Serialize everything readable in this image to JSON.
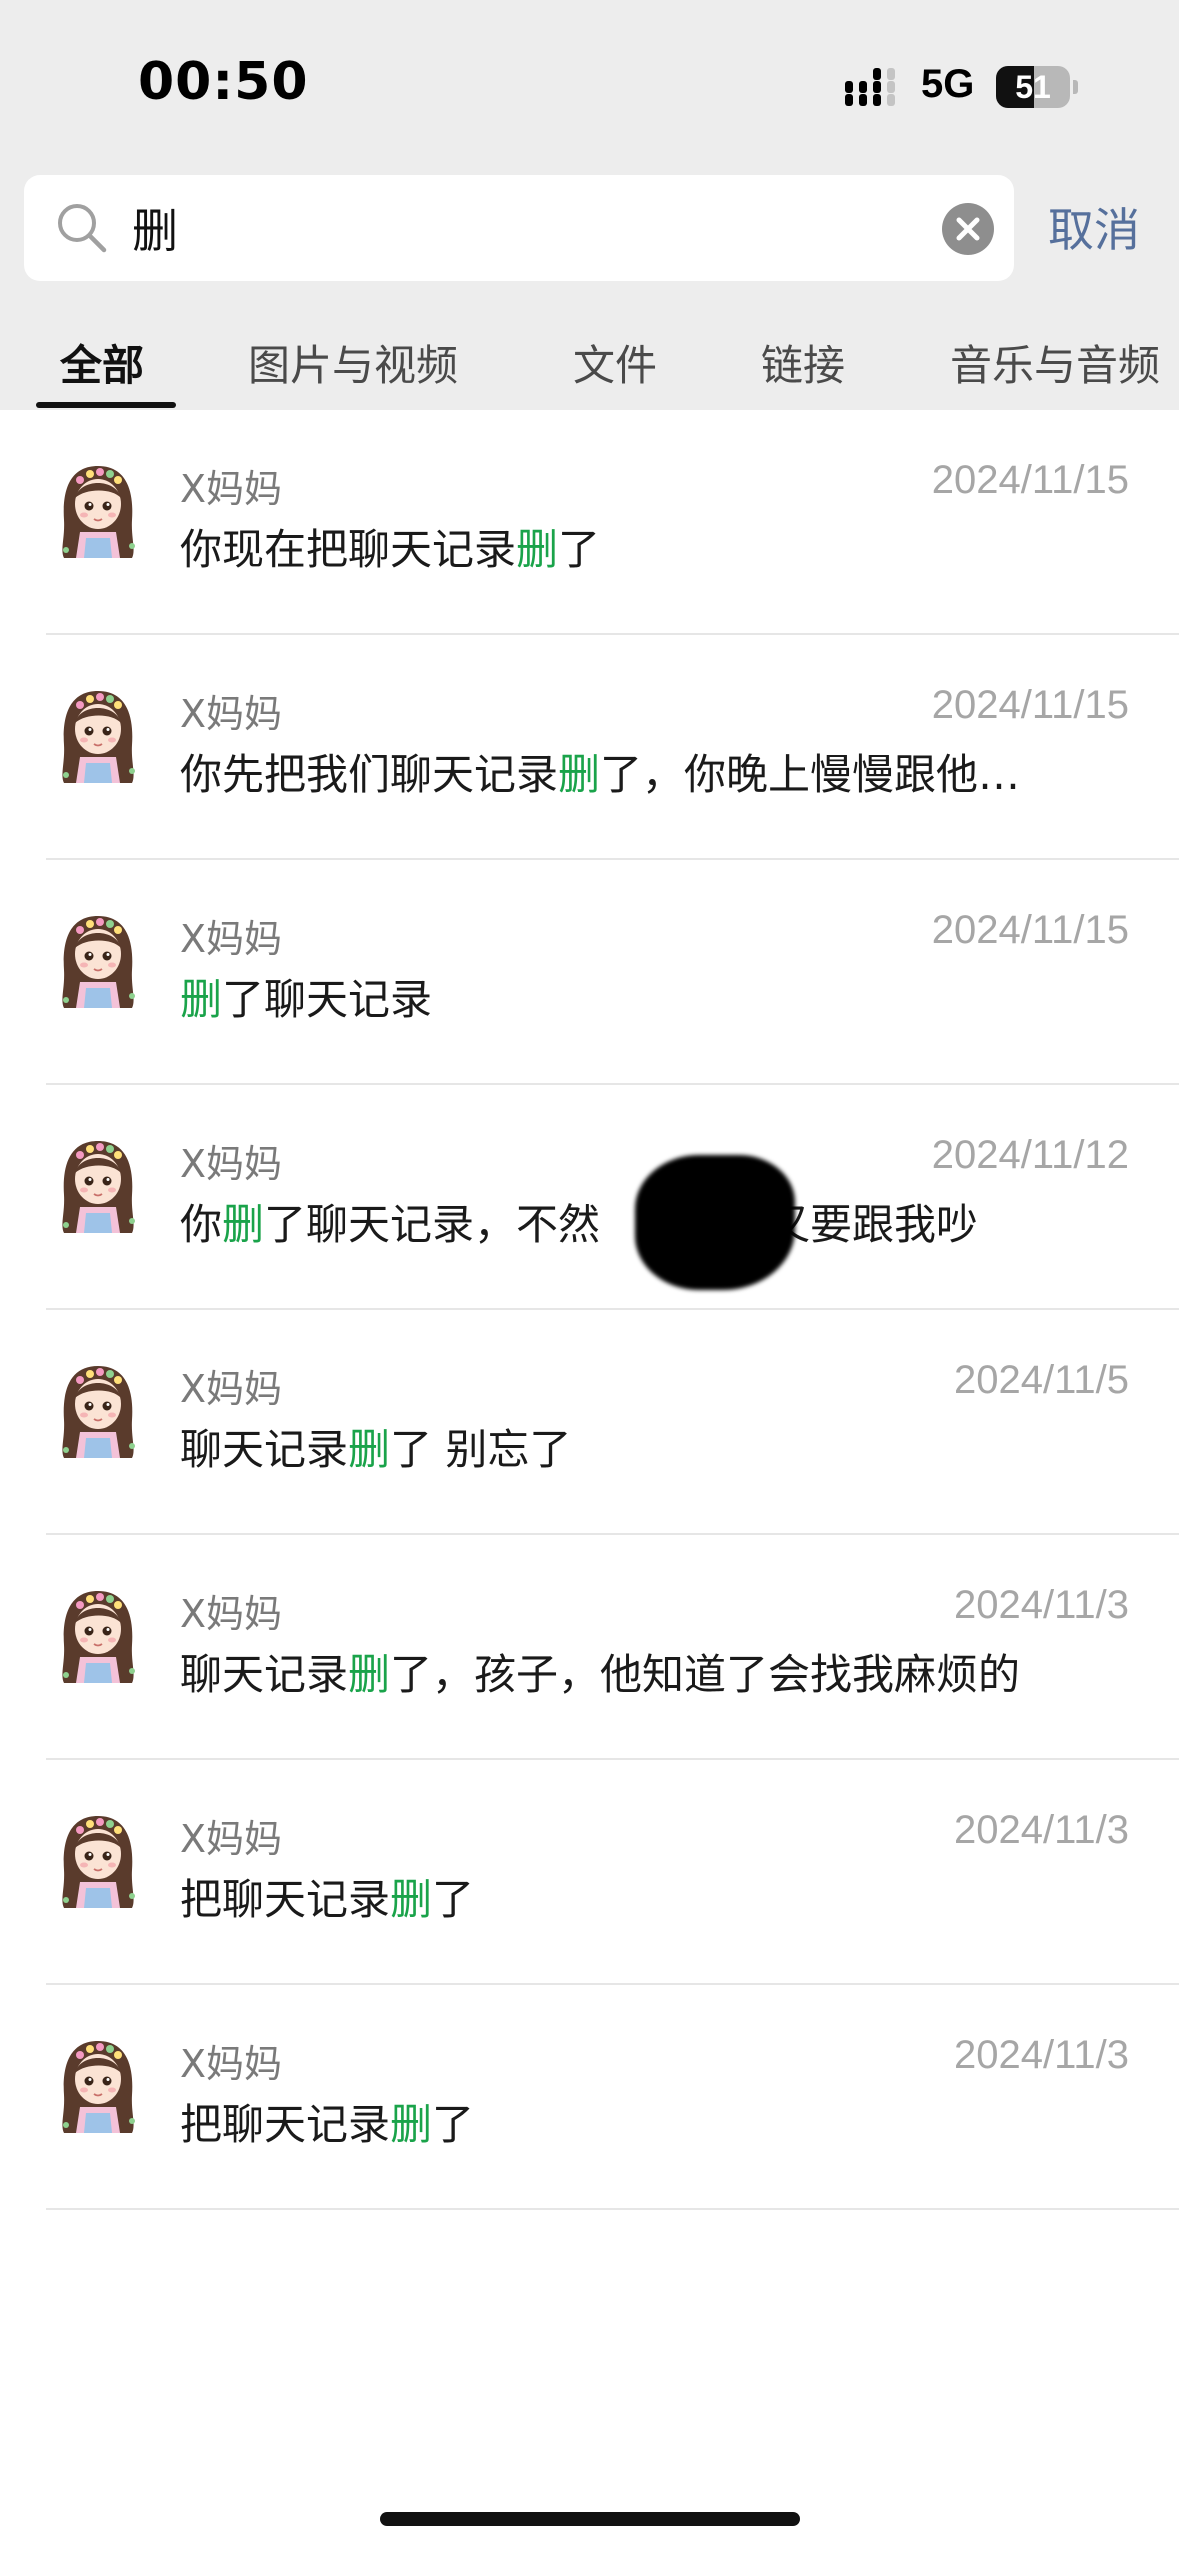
{
  "status_bar": {
    "time": "00:50",
    "network": "5G",
    "battery_level": "51",
    "battery_fraction": 0.51
  },
  "search": {
    "query": "删",
    "cancel_label": "取消"
  },
  "tabs": [
    {
      "label": "全部",
      "active": true
    },
    {
      "label": "图片与视频",
      "active": false
    },
    {
      "label": "文件",
      "active": false
    },
    {
      "label": "链接",
      "active": false
    },
    {
      "label": "音乐与音频",
      "active": false
    }
  ],
  "highlight_color": "#1aa34a",
  "results": [
    {
      "sender": "X妈妈",
      "date": "2024/11/15",
      "before": "你现在把聊天记录",
      "match": "删",
      "after": "了"
    },
    {
      "sender": "X妈妈",
      "date": "2024/11/15",
      "before": "你先把我们聊天记录",
      "match": "删",
      "after": "了，你晚上慢慢跟他…"
    },
    {
      "sender": "X妈妈",
      "date": "2024/11/15",
      "before": "",
      "match": "删",
      "after": "了聊天记录"
    },
    {
      "sender": "X妈妈",
      "date": "2024/11/12",
      "before": "你",
      "match": "删",
      "after": "了聊天记录，不然　　　　又要跟我吵"
    },
    {
      "sender": "X妈妈",
      "date": "2024/11/5",
      "before": "聊天记录",
      "match": "删",
      "after": "了 别忘了"
    },
    {
      "sender": "X妈妈",
      "date": "2024/11/3",
      "before": "聊天记录",
      "match": "删",
      "after": "了，孩子，他知道了会找我麻烦的"
    },
    {
      "sender": "X妈妈",
      "date": "2024/11/3",
      "before": "把聊天记录",
      "match": "删",
      "after": "了"
    },
    {
      "sender": "X妈妈",
      "date": "2024/11/3",
      "before": "把聊天记录",
      "match": "删",
      "after": "了"
    }
  ]
}
